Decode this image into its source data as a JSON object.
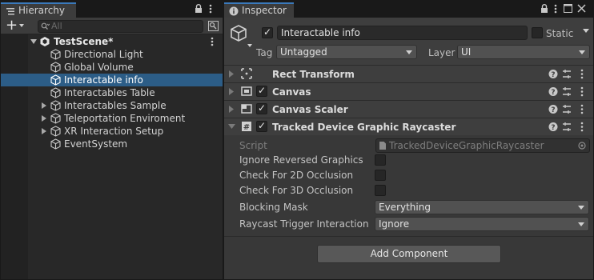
{
  "hierarchy": {
    "tab_label": "Hierarchy",
    "add_label": "+",
    "search_placeholder": "All",
    "scene_name": "TestScene*",
    "items": [
      {
        "label": "Directional Light",
        "expandable": false,
        "selected": false
      },
      {
        "label": "Global Volume",
        "expandable": false,
        "selected": false
      },
      {
        "label": "Interactable info",
        "expandable": false,
        "selected": true
      },
      {
        "label": "Interactables Table",
        "expandable": false,
        "selected": false
      },
      {
        "label": "Interactables Sample",
        "expandable": true,
        "selected": false
      },
      {
        "label": "Teleportation Enviroment",
        "expandable": true,
        "selected": false
      },
      {
        "label": "XR Interaction Setup",
        "expandable": true,
        "selected": false
      },
      {
        "label": "EventSystem",
        "expandable": false,
        "selected": false
      }
    ]
  },
  "inspector": {
    "tab_label": "Inspector",
    "object_name": "Interactable info",
    "static_label": "Static",
    "tag_label": "Tag",
    "tag_value": "Untagged",
    "layer_label": "Layer",
    "layer_value": "UI",
    "components": [
      {
        "name": "Rect Transform",
        "has_checkbox": false,
        "expanded": false
      },
      {
        "name": "Canvas",
        "has_checkbox": true,
        "expanded": false
      },
      {
        "name": "Canvas Scaler",
        "has_checkbox": true,
        "expanded": false
      },
      {
        "name": "Tracked Device Graphic Raycaster",
        "has_checkbox": true,
        "expanded": true
      }
    ],
    "raycaster": {
      "script_label": "Script",
      "script_value": "TrackedDeviceGraphicRaycaster",
      "ignore_reversed_label": "Ignore Reversed Graphics",
      "check_2d_label": "Check For 2D Occlusion",
      "check_3d_label": "Check For 3D Occlusion",
      "blocking_mask_label": "Blocking Mask",
      "blocking_mask_value": "Everything",
      "trigger_label": "Raycast Trigger Interaction",
      "trigger_value": "Ignore"
    },
    "add_component_label": "Add Component"
  },
  "colors": {
    "selection": "#2c5d87",
    "tab_accent": "#3a79bb",
    "panel_bg": "#383838"
  }
}
